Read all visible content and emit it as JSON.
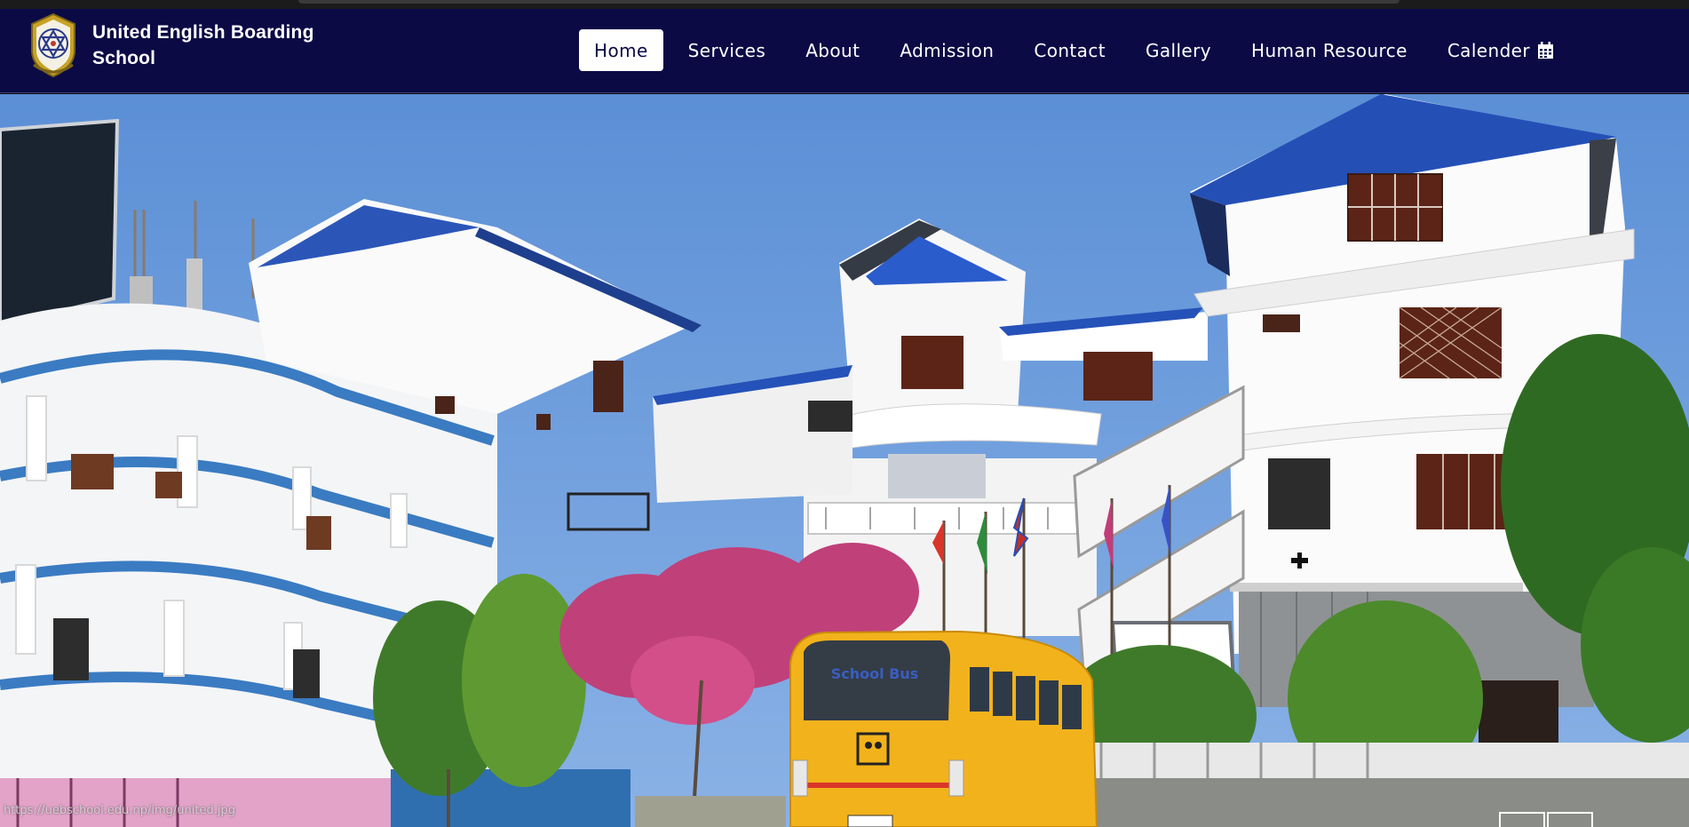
{
  "browser": {
    "status_url": "https://uebschool.edu.np/img/united.jpg"
  },
  "site": {
    "name": "United English Boarding School",
    "logo_icon": "school-emblem-icon"
  },
  "nav": {
    "items": [
      {
        "label": "Home",
        "active": true
      },
      {
        "label": "Services",
        "active": false
      },
      {
        "label": "About",
        "active": false
      },
      {
        "label": "Admission",
        "active": false
      },
      {
        "label": "Contact",
        "active": false
      },
      {
        "label": "Gallery",
        "active": false
      },
      {
        "label": "Human Resource",
        "active": false
      },
      {
        "label": "Calender",
        "active": false,
        "icon": "calendar-icon"
      }
    ]
  },
  "hero": {
    "bus_label": "School Bus"
  },
  "colors": {
    "navbar_bg": "#0c0a45",
    "nav_text": "#ffffff",
    "active_bg": "#ffffff",
    "sky": "#6f9edb",
    "roof_blue": "#1f4fbd",
    "bus_yellow": "#f2b21b"
  }
}
